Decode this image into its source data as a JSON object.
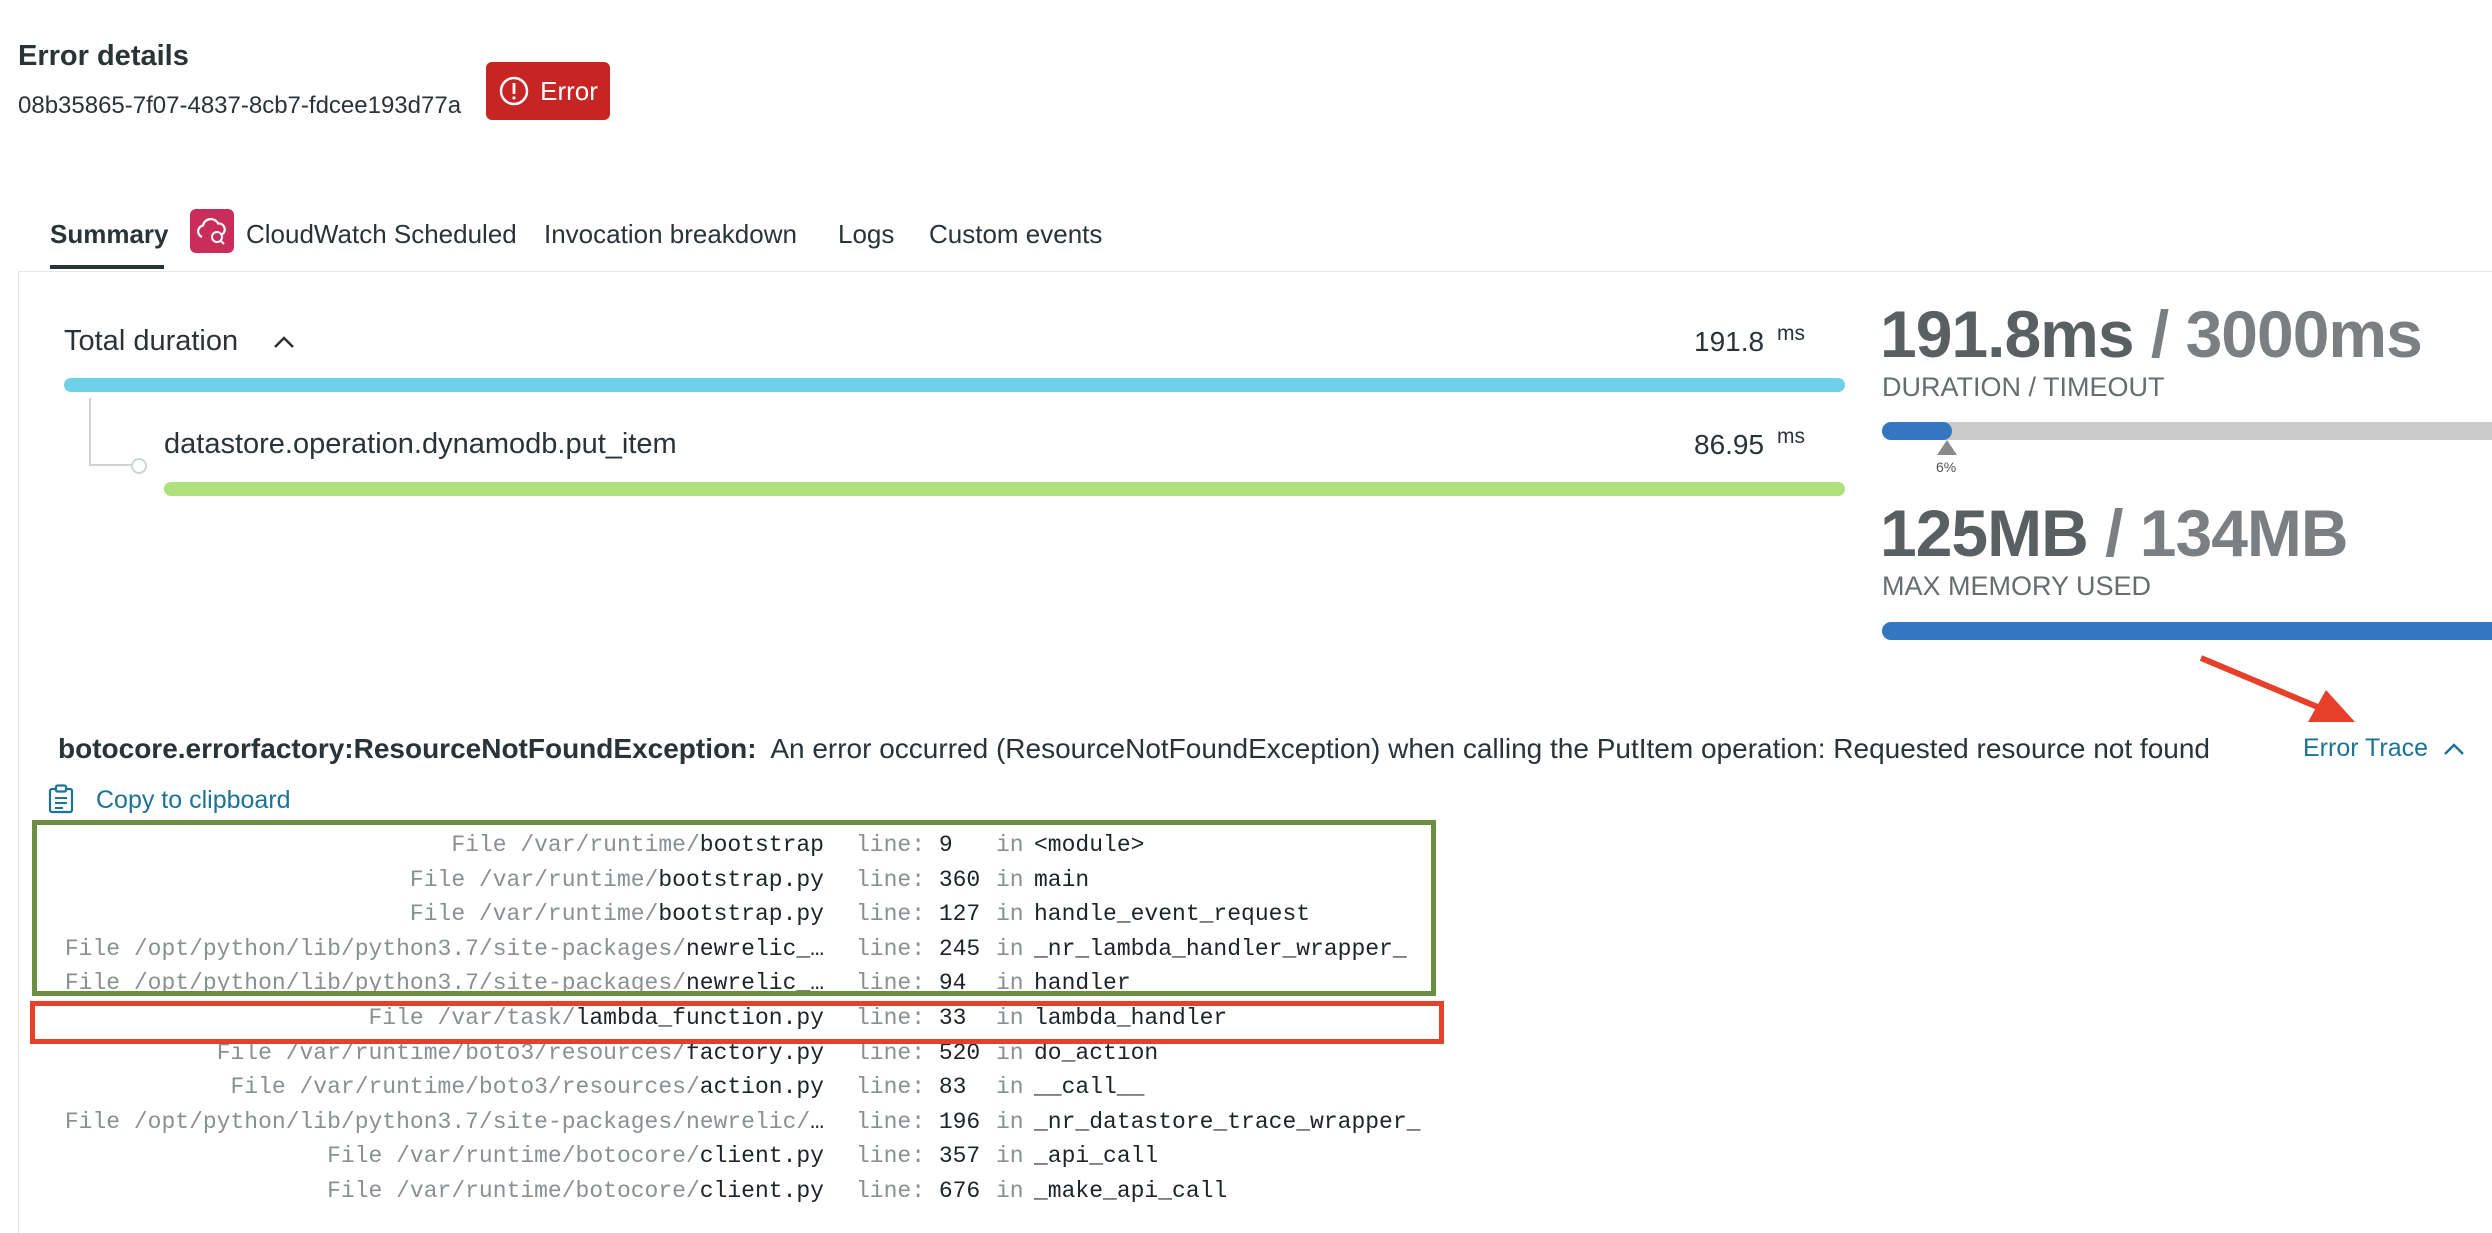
{
  "header": {
    "title": "Error details",
    "id": "08b35865-7f07-4837-8cb7-fdcee193d77a",
    "badge": "Error"
  },
  "tabs": [
    {
      "label": "Summary"
    },
    {
      "label": "CloudWatch Scheduled"
    },
    {
      "label": "Invocation breakdown"
    },
    {
      "label": "Logs"
    },
    {
      "label": "Custom events"
    }
  ],
  "duration": {
    "total_label": "Total duration",
    "total_value": "191.8",
    "unit": "ms",
    "child_label": "datastore.operation.dynamodb.put_item",
    "child_value": "86.95",
    "total_bar_color": "#6fd0ea",
    "child_bar_color": "#aee07b"
  },
  "stats": {
    "duration_used": "191.8ms",
    "duration_sep": " / ",
    "duration_timeout": "3000ms",
    "duration_caption": "DURATION / TIMEOUT",
    "duration_pct": "6%",
    "duration_fraction": 0.064,
    "memory_used": "125MB",
    "memory_sep": " / ",
    "memory_total": "134MB",
    "memory_caption": "MAX MEMORY USED",
    "memory_fraction": 0.93
  },
  "error": {
    "exception_name": "botocore.errorfactory:ResourceNotFoundException:",
    "message": "An error occurred (ResourceNotFoundException) when calling the PutItem operation: Requested resource not found",
    "trace_link": "Error Trace",
    "copy_label": "Copy to clipboard"
  },
  "trace": {
    "line_key": "line:",
    "in_key": "in",
    "rows": [
      {
        "path": "File /var/runtime/",
        "file": "bootstrap",
        "line": "9",
        "fn": "<module>"
      },
      {
        "path": "File /var/runtime/",
        "file": "bootstrap.py",
        "line": "360",
        "fn": "main"
      },
      {
        "path": "File /var/runtime/",
        "file": "bootstrap.py",
        "line": "127",
        "fn": "handle_event_request"
      },
      {
        "path": "File /opt/python/lib/python3.7/site-packages/",
        "file": "newrelic_…",
        "line": "245",
        "fn": "_nr_lambda_handler_wrapper_"
      },
      {
        "path": "File /opt/python/lib/python3.7/site-packages/",
        "file": "newrelic_…",
        "line": "94",
        "fn": "handler"
      },
      {
        "path": "File /var/task/",
        "file": "lambda_function.py",
        "line": "33",
        "fn": "lambda_handler"
      },
      {
        "path": "File /var/runtime/boto3/resources/",
        "file": "factory.py",
        "line": "520",
        "fn": "do_action"
      },
      {
        "path": "File /var/runtime/boto3/resources/",
        "file": "action.py",
        "line": "83",
        "fn": "__call__"
      },
      {
        "path": "File /opt/python/lib/python3.7/site-packages/newrelic/",
        "file": "…",
        "line": "196",
        "fn": "_nr_datastore_trace_wrapper_"
      },
      {
        "path": "File /var/runtime/botocore/",
        "file": "client.py",
        "line": "357",
        "fn": "_api_call"
      },
      {
        "path": "File /var/runtime/botocore/",
        "file": "client.py",
        "line": "676",
        "fn": "_make_api_call"
      }
    ]
  },
  "icons": {
    "badge_icon": "alert-circle-icon",
    "cloudwatch_icon": "cloudwatch-icon",
    "clipboard_icon": "clipboard-icon"
  },
  "colors": {
    "error_red": "#c72424",
    "link_blue": "#1d7396",
    "progress_blue": "#3476bf",
    "annotation_green": "#6b8f3e",
    "annotation_red": "#e6402a"
  }
}
